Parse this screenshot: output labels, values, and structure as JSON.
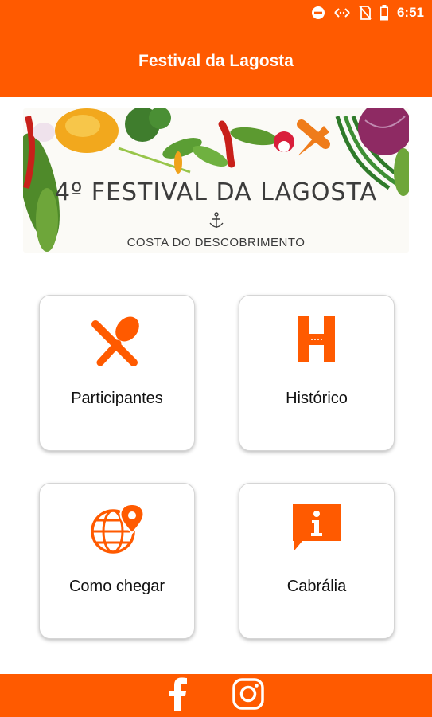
{
  "status_bar": {
    "time": "6:51"
  },
  "app_bar": {
    "title": "Festival da Lagosta"
  },
  "banner": {
    "title": "4º FESTIVAL DA LAGOSTA",
    "subtitle": "COSTA DO DESCOBRIMENTO"
  },
  "menu": {
    "participantes": {
      "label": "Participantes",
      "icon": "cutlery-icon"
    },
    "historico": {
      "label": "Histórico",
      "icon": "history-h-icon"
    },
    "como_chegar": {
      "label": "Como chegar",
      "icon": "globe-location-icon"
    },
    "cabralia": {
      "label": "Cabrália",
      "icon": "info-icon"
    }
  },
  "footer": {
    "facebook_icon": "facebook-icon",
    "instagram_icon": "instagram-icon"
  },
  "colors": {
    "accent": "#ff5a00",
    "background": "#ffffff",
    "tile_border": "#d5d5d5"
  }
}
